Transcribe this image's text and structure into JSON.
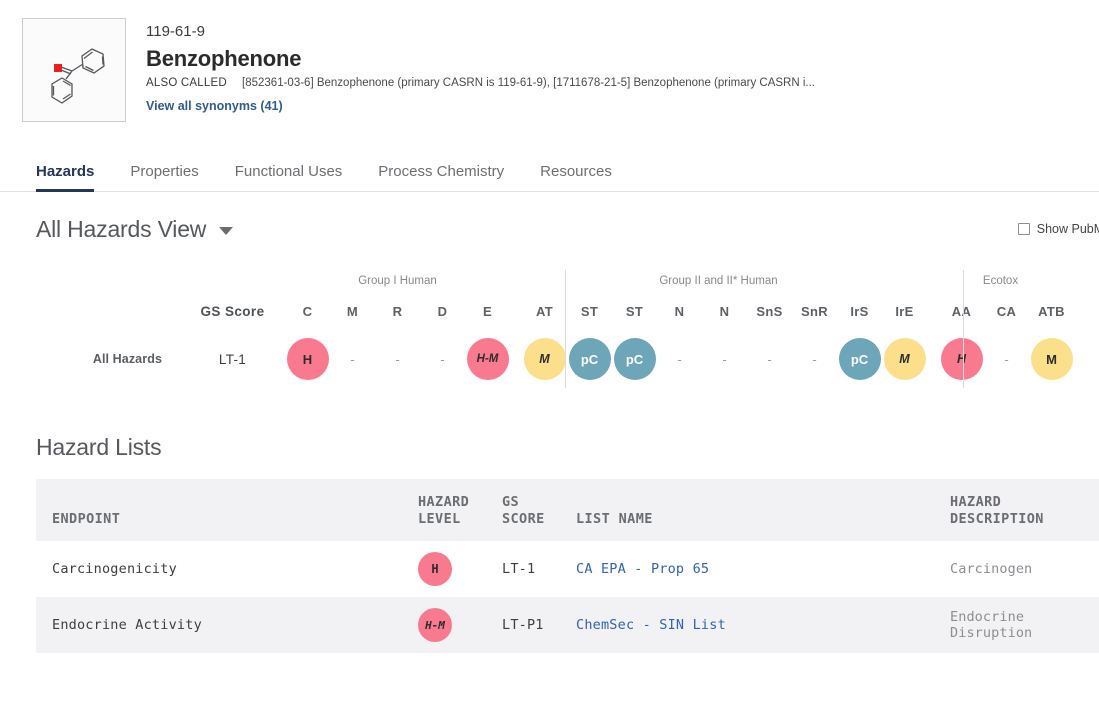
{
  "header": {
    "casrn": "119-61-9",
    "chemical_name": "Benzophenone",
    "also_called_label": "ALSO CALLED",
    "also_called_value": "[852361-03-6] Benzophenone (primary CASRN is 119-61-9), [1711678-21-5] Benzophenone (primary CASRN i...",
    "synonyms_link": "View all synonyms (41)",
    "structure_icon": "benzophenone-structure"
  },
  "tabs": [
    {
      "label": "Hazards",
      "active": true
    },
    {
      "label": "Properties",
      "active": false
    },
    {
      "label": "Functional Uses",
      "active": false
    },
    {
      "label": "Process Chemistry",
      "active": false
    },
    {
      "label": "Resources",
      "active": false
    }
  ],
  "view_selector": {
    "label": "All Hazards View",
    "caret_icon": "chevron-down-icon"
  },
  "pubmed_toggle": {
    "label": "Show PubMed I",
    "checked": false,
    "checkbox_icon": "checkbox-unchecked-icon"
  },
  "hazard_grid": {
    "row_label": "All Hazards",
    "gs_score_header": "GS Score",
    "gs_score_value": "LT-1",
    "groups": [
      {
        "label": "Group I Human"
      },
      {
        "label": "Group II and II* Human"
      },
      {
        "label": "Ecotox"
      }
    ],
    "columns": [
      {
        "code": "C",
        "group": 0,
        "value": "H",
        "color": "pink",
        "style": "bold"
      },
      {
        "code": "M",
        "group": 0,
        "value": "-",
        "color": "none",
        "style": "dash"
      },
      {
        "code": "R",
        "group": 0,
        "value": "-",
        "color": "none",
        "style": "dash"
      },
      {
        "code": "D",
        "group": 0,
        "value": "-",
        "color": "none",
        "style": "dash"
      },
      {
        "code": "E",
        "group": 0,
        "value": "H-M",
        "color": "pink",
        "style": "italic"
      },
      {
        "code": "AT",
        "group": 1,
        "value": "M",
        "color": "yellow",
        "style": "italic"
      },
      {
        "code": "ST",
        "group": 1,
        "value": "pC",
        "color": "teal",
        "style": "bold"
      },
      {
        "code": "ST",
        "group": 1,
        "value": "pC",
        "color": "teal",
        "style": "bold"
      },
      {
        "code": "N",
        "group": 1,
        "value": "-",
        "color": "none",
        "style": "dash"
      },
      {
        "code": "N",
        "group": 1,
        "value": "-",
        "color": "none",
        "style": "dash"
      },
      {
        "code": "SnS",
        "group": 1,
        "value": "-",
        "color": "none",
        "style": "dash"
      },
      {
        "code": "SnR",
        "group": 1,
        "value": "-",
        "color": "none",
        "style": "dash"
      },
      {
        "code": "IrS",
        "group": 1,
        "value": "pC",
        "color": "teal",
        "style": "bold"
      },
      {
        "code": "IrE",
        "group": 1,
        "value": "M",
        "color": "yellow",
        "style": "italic"
      },
      {
        "code": "AA",
        "group": 2,
        "value": "H",
        "color": "pink",
        "style": "italic"
      },
      {
        "code": "CA",
        "group": 2,
        "value": "-",
        "color": "none",
        "style": "dash"
      },
      {
        "code": "ATB",
        "group": 2,
        "value": "M",
        "color": "yellow",
        "style": "bold"
      }
    ]
  },
  "hazard_lists": {
    "title": "Hazard Lists",
    "headers": {
      "endpoint": "ENDPOINT",
      "hazard_level_1": "HAZARD",
      "hazard_level_2": "LEVEL",
      "gs_score_1": "GS",
      "gs_score_2": "SCORE",
      "list_name": "LIST NAME",
      "hazard_description": "HAZARD DESCRIPTION"
    },
    "rows": [
      {
        "endpoint": "Carcinogenicity",
        "hazard_level": "H",
        "hazard_style": "bold",
        "gs_score": "LT-1",
        "list_name": "CA EPA - Prop 65",
        "hazard_description": "Carcinogen"
      },
      {
        "endpoint": "Endocrine Activity",
        "hazard_level": "H-M",
        "hazard_style": "italic",
        "gs_score": "LT-P1",
        "list_name": "ChemSec - SIN List",
        "hazard_description": "Endocrine Disruption"
      }
    ]
  },
  "colors": {
    "pink": "#f97a8e",
    "yellow": "#fbdf8a",
    "teal": "#6ca6b8",
    "link": "#2f62b8",
    "tab_active": "#23365c"
  }
}
